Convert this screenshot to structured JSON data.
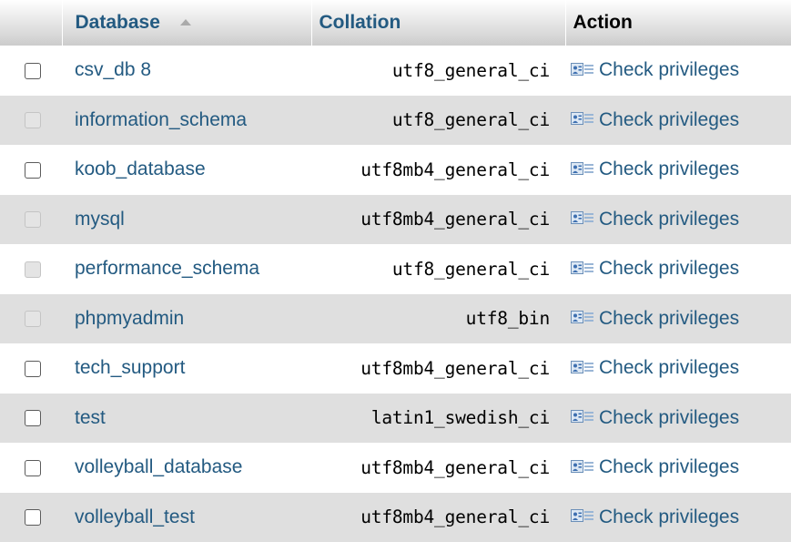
{
  "header": {
    "database_label": "Database",
    "collation_label": "Collation",
    "action_label": "Action"
  },
  "rows": [
    {
      "name": "csv_db 8",
      "collation": "utf8_general_ci",
      "action": "Check privileges",
      "checkbox_enabled": true
    },
    {
      "name": "information_schema",
      "collation": "utf8_general_ci",
      "action": "Check privileges",
      "checkbox_enabled": false
    },
    {
      "name": "koob_database",
      "collation": "utf8mb4_general_ci",
      "action": "Check privileges",
      "checkbox_enabled": true
    },
    {
      "name": "mysql",
      "collation": "utf8mb4_general_ci",
      "action": "Check privileges",
      "checkbox_enabled": false
    },
    {
      "name": "performance_schema",
      "collation": "utf8_general_ci",
      "action": "Check privileges",
      "checkbox_enabled": false
    },
    {
      "name": "phpmyadmin",
      "collation": "utf8_bin",
      "action": "Check privileges",
      "checkbox_enabled": false
    },
    {
      "name": "tech_support",
      "collation": "utf8mb4_general_ci",
      "action": "Check privileges",
      "checkbox_enabled": true
    },
    {
      "name": "test",
      "collation": "latin1_swedish_ci",
      "action": "Check privileges",
      "checkbox_enabled": true
    },
    {
      "name": "volleyball_database",
      "collation": "utf8mb4_general_ci",
      "action": "Check privileges",
      "checkbox_enabled": true
    },
    {
      "name": "volleyball_test",
      "collation": "utf8mb4_general_ci",
      "action": "Check privileges",
      "checkbox_enabled": true
    }
  ],
  "icons": {
    "sort": "sort-ascending-icon",
    "privileges": "privileges-icon",
    "checkbox": "checkbox"
  },
  "colors": {
    "link": "#235a81",
    "row_alt": "#dfdfdf",
    "row_base": "#ffffff"
  }
}
